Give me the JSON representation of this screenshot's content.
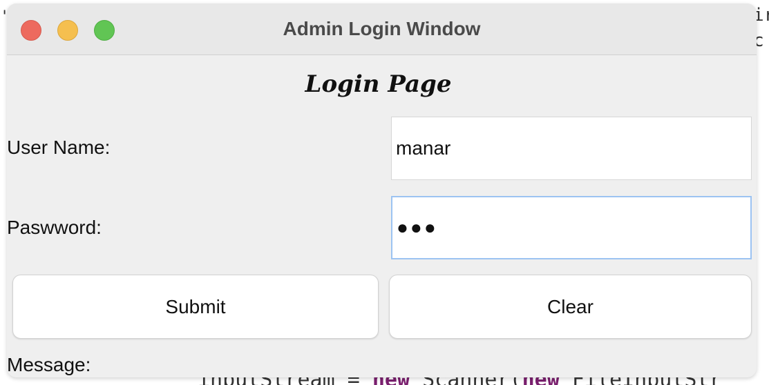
{
  "window": {
    "title": "Admin Login Window"
  },
  "page": {
    "title": "Login Page"
  },
  "form": {
    "username_label": "User Name:",
    "username_value": "manar",
    "password_label": "Paswword:",
    "password_mask": "●●●",
    "submit_label": "Submit",
    "clear_label": "Clear",
    "message_label": "Message:"
  },
  "background": {
    "code_prefix": "inputStream = ",
    "code_kw1": "new",
    "code_mid": " Scanner(",
    "code_kw2": "new",
    "code_suffix": " FileInputStr",
    "right_fragment_1": "ir",
    "right_fragment_2": "c",
    "left_fragment": "'"
  },
  "colors": {
    "close": "#ed6a5e",
    "minimize": "#f5bf4f",
    "maximize": "#61c554",
    "focus_ring": "#9cc3f2"
  }
}
